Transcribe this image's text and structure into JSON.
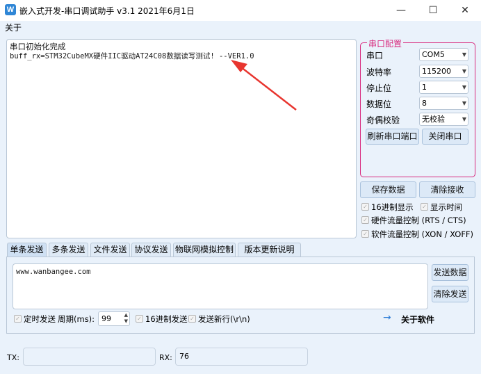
{
  "window": {
    "title": "嵌入式开发-串口调试助手 v3.1 2021年6月1日",
    "icon_letter": "W",
    "minimize_glyph": "—",
    "maximize_glyph": "☐",
    "close_glyph": "✕"
  },
  "menu": {
    "about": "关于"
  },
  "receive": {
    "lines": [
      "串口初始化完成",
      "buff_rx=STM32CubeMX硬件IIC驱动AT24C08数据读写测试! --VER1.0"
    ]
  },
  "serial_config": {
    "legend": "串口配置",
    "port_label": "串口",
    "port_value": "COM5",
    "baud_label": "波特率",
    "baud_value": "115200",
    "stop_label": "停止位",
    "stop_value": "1",
    "data_label": "数据位",
    "data_value": "8",
    "parity_label": "奇偶校验",
    "parity_value": "无校验",
    "refresh_button": "刷新串口端口",
    "close_button": "关闭串口"
  },
  "receive_controls": {
    "save_button": "保存数据",
    "clear_button": "清除接收",
    "hex_display": "16进制显示",
    "show_time": "显示时间",
    "hw_flow": "硬件流量控制 (RTS / CTS)",
    "sw_flow": "软件流量控制 (XON / XOFF)"
  },
  "tabs": [
    "单条发送",
    "多条发送",
    "文件发送",
    "协议发送",
    "物联网模拟控制",
    "版本更新说明"
  ],
  "send": {
    "text": "www.wanbangee.com",
    "send_button": "发送数据",
    "clear_button": "清除发送",
    "timed_send": "定时发送",
    "period_label": "周期(ms):",
    "period_value": "99",
    "hex_send": "16进制发送",
    "newline": "发送新行(\\r\\n)",
    "about_software": "关于软件"
  },
  "status": {
    "tx_label": "TX:",
    "tx_value": "",
    "rx_label": "RX:",
    "rx_value": "76"
  },
  "colors": {
    "accent": "#d82a7e",
    "arrow": "#e8352f",
    "link_arrow": "#2b7bd6"
  },
  "icons": {
    "combo_arrow": "chevron-down-icon",
    "about_arrow": "arrow-right-icon"
  }
}
